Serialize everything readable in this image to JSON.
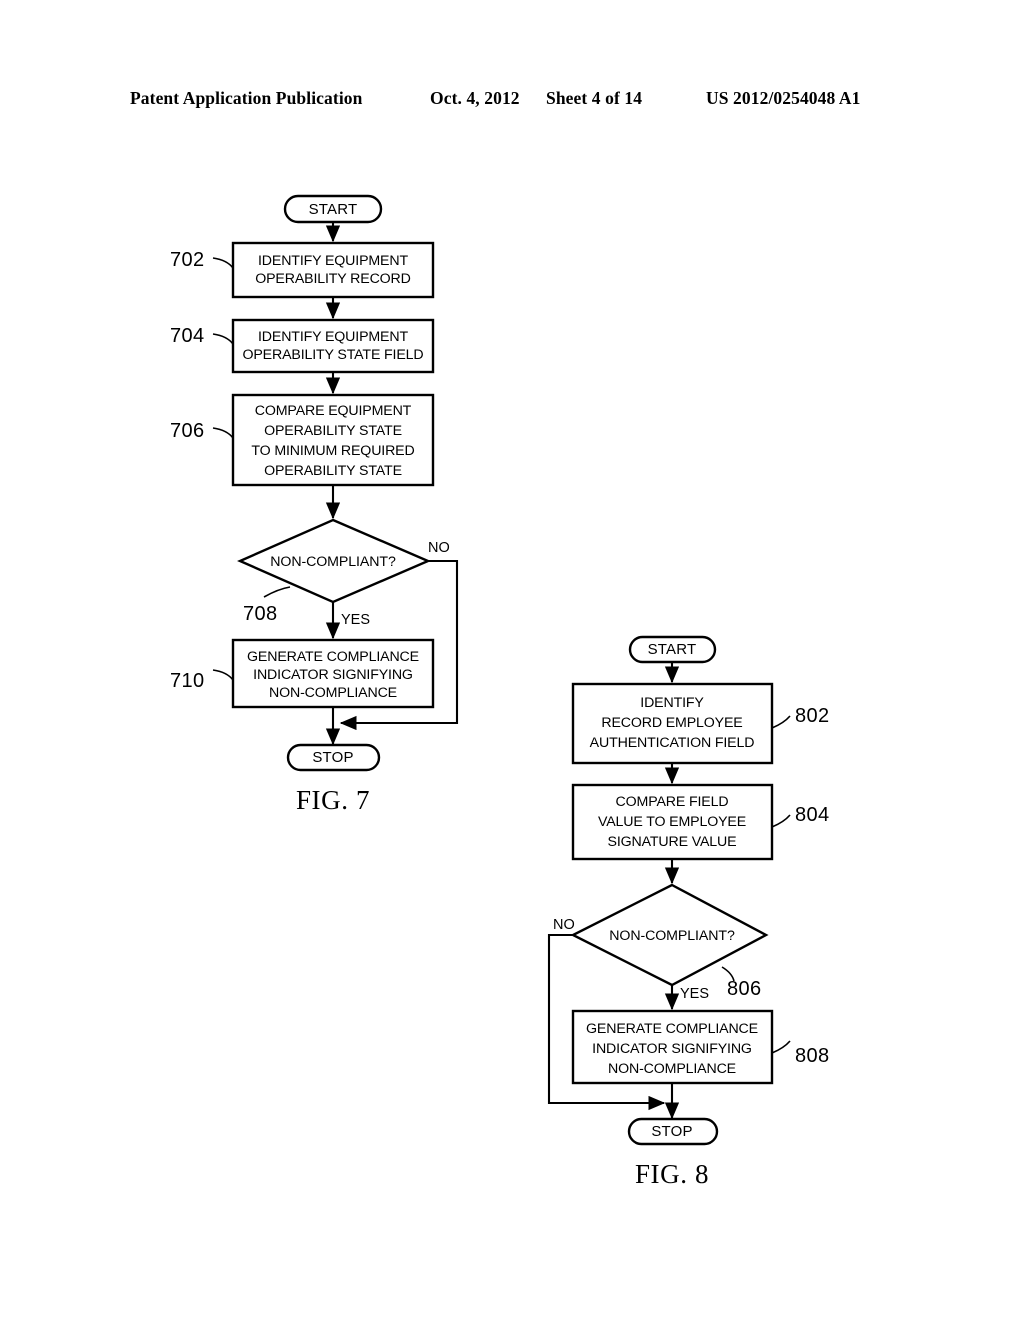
{
  "header": {
    "publication": "Patent Application Publication",
    "date": "Oct. 4, 2012",
    "sheet": "Sheet 4 of 14",
    "number": "US 2012/0254048 A1"
  },
  "figures": [
    {
      "caption": "FIG. 7",
      "nodes": {
        "start": "START",
        "stop": "STOP",
        "step702": [
          "IDENTIFY EQUIPMENT",
          "OPERABILITY RECORD"
        ],
        "step704": [
          "IDENTIFY EQUIPMENT",
          "OPERABILITY STATE FIELD"
        ],
        "step706": [
          "COMPARE EQUIPMENT",
          "OPERABILITY STATE",
          "TO MINIMUM REQUIRED",
          "OPERABILITY STATE"
        ],
        "decision708": "NON-COMPLIANT?",
        "step710": [
          "GENERATE COMPLIANCE",
          "INDICATOR SIGNIFYING",
          "NON-COMPLIANCE"
        ]
      },
      "refs": {
        "r702": "702",
        "r704": "704",
        "r706": "706",
        "r708": "708",
        "r710": "710"
      },
      "branches": {
        "no": "NO",
        "yes": "YES"
      }
    },
    {
      "caption": "FIG. 8",
      "nodes": {
        "start": "START",
        "stop": "STOP",
        "step802": [
          "IDENTIFY",
          "RECORD EMPLOYEE",
          "AUTHENTICATION FIELD"
        ],
        "step804": [
          "COMPARE FIELD",
          "VALUE TO EMPLOYEE",
          "SIGNATURE VALUE"
        ],
        "decision806": "NON-COMPLIANT?",
        "step808": [
          "GENERATE COMPLIANCE",
          "INDICATOR SIGNIFYING",
          "NON-COMPLIANCE"
        ]
      },
      "refs": {
        "r802": "802",
        "r804": "804",
        "r806": "806",
        "r808": "808"
      },
      "branches": {
        "no": "NO",
        "yes": "YES"
      }
    }
  ]
}
